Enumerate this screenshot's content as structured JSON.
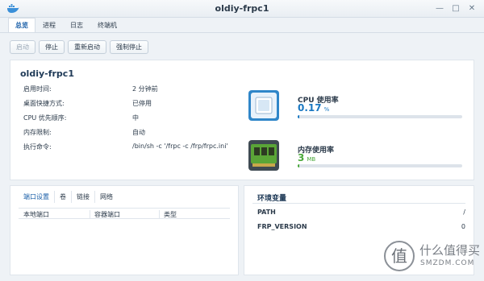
{
  "window": {
    "title": "oldiy-frpc1",
    "controls": [
      "minimize-icon",
      "maximize-icon",
      "close-icon"
    ]
  },
  "tabs": [
    {
      "label": "总览",
      "active": true
    },
    {
      "label": "进程",
      "active": false
    },
    {
      "label": "日志",
      "active": false
    },
    {
      "label": "终端机",
      "active": false
    }
  ],
  "toolbar": {
    "start": "启动",
    "stop": "停止",
    "restart": "重新启动",
    "force_stop": "强制停止"
  },
  "container": {
    "name": "oldiy-frpc1",
    "info": [
      {
        "key": "启用时间:",
        "value": "2 分钟前"
      },
      {
        "key": "桌面快捷方式:",
        "value": "已停用"
      },
      {
        "key": "CPU 优先顺序:",
        "value": "中"
      },
      {
        "key": "内存限制:",
        "value": "自动"
      },
      {
        "key": "执行命令:",
        "value": "/bin/sh -c '/frpc -c /frp/frpc.ini'"
      }
    ]
  },
  "metrics": {
    "cpu": {
      "label": "CPU 使用率",
      "value": "0.17",
      "unit": "%",
      "percent": 0.17,
      "color": "#1a78c2",
      "icon": "cpu-icon"
    },
    "memory": {
      "label": "内存使用率",
      "value": "3",
      "unit": "MB",
      "percent": 0.3,
      "color": "#4aa83a",
      "icon": "memory-icon"
    }
  },
  "ports": {
    "tabs": [
      "端口设置",
      "卷",
      "链接",
      "网络"
    ],
    "columns": [
      "本地端口",
      "容器端口",
      "类型"
    ]
  },
  "env": {
    "title": "环境变量",
    "rows": [
      {
        "key": "PATH",
        "value": "/"
      },
      {
        "key": "FRP_VERSION",
        "value": "0"
      }
    ]
  },
  "watermark": {
    "glyph": "值",
    "text": "什么值得买",
    "sub": "SMZDM.COM"
  }
}
